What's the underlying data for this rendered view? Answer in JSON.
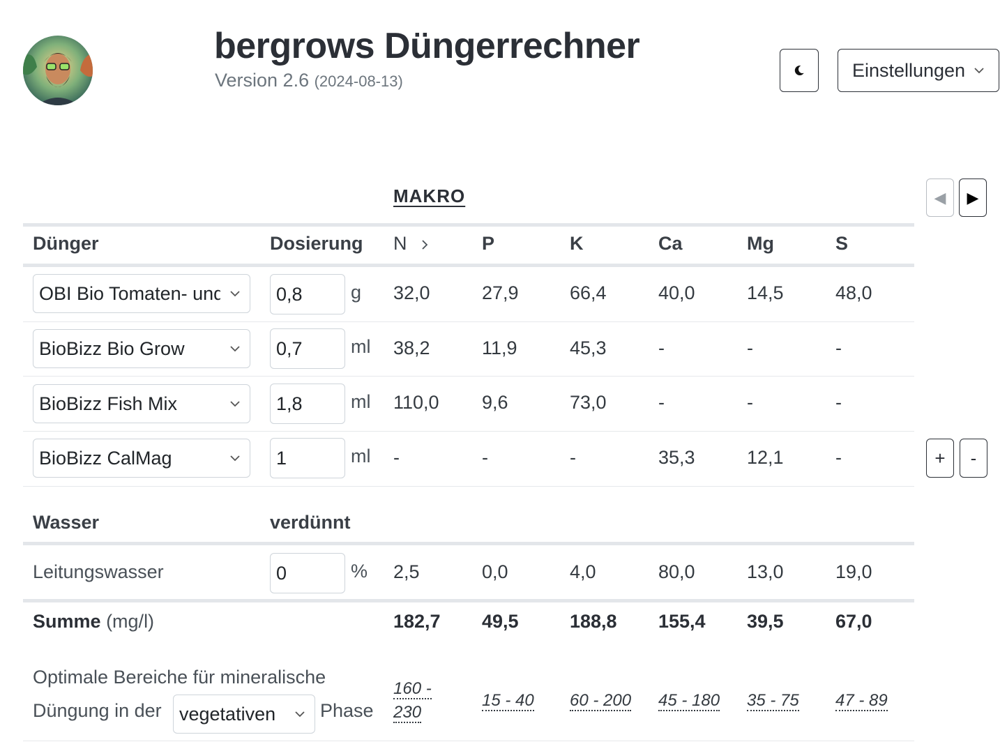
{
  "header": {
    "title": "bergrows Düngerrechner",
    "version": "Version 2.6",
    "date": "(2024-08-13)",
    "theme_icon": "moon-icon",
    "settings_label": "Einstellungen"
  },
  "section": {
    "heading": "MAKRO",
    "prev_icon": "◀",
    "next_icon": "▶"
  },
  "columns": {
    "duenger": "Dünger",
    "dosierung": "Dosierung",
    "nutrients": [
      "N",
      "P",
      "K",
      "Ca",
      "Mg",
      "S"
    ]
  },
  "fertilizers": [
    {
      "name": "OBI Bio Tomaten- und",
      "dose": "0,8",
      "unit": "g",
      "values": [
        "32,0",
        "27,9",
        "66,4",
        "40,0",
        "14,5",
        "48,0"
      ]
    },
    {
      "name": "BioBizz Bio Grow",
      "dose": "0,7",
      "unit": "ml",
      "values": [
        "38,2",
        "11,9",
        "45,3",
        "-",
        "-",
        "-"
      ]
    },
    {
      "name": "BioBizz Fish Mix",
      "dose": "1,8",
      "unit": "ml",
      "values": [
        "110,0",
        "9,6",
        "73,0",
        "-",
        "-",
        "-"
      ]
    },
    {
      "name": "BioBizz CalMag",
      "dose": "1",
      "unit": "ml",
      "values": [
        "-",
        "-",
        "-",
        "35,3",
        "12,1",
        "-"
      ]
    }
  ],
  "row_buttons": {
    "add": "+",
    "remove": "-"
  },
  "water": {
    "header_label": "Wasser",
    "header_dilution": "verdünnt",
    "name": "Leitungswasser",
    "dilution": "0",
    "unit": "%",
    "values": [
      "2,5",
      "0,0",
      "4,0",
      "80,0",
      "13,0",
      "19,0"
    ]
  },
  "sum": {
    "label": "Summe",
    "unit": "(mg/l)",
    "values": [
      "182,7",
      "49,5",
      "188,8",
      "155,4",
      "39,5",
      "67,0"
    ]
  },
  "optimal": {
    "line1": "Optimale Bereiche für mineralische",
    "line2_prefix": "Düngung in der",
    "phase_selected": "vegetativen",
    "line2_suffix": "Phase",
    "ranges": [
      "160 - 230",
      "15 - 40",
      "60 - 200",
      "45 - 180",
      "35 - 75",
      "47 - 89"
    ],
    "n_range_part1": "160 -",
    "n_range_part2": "230"
  }
}
